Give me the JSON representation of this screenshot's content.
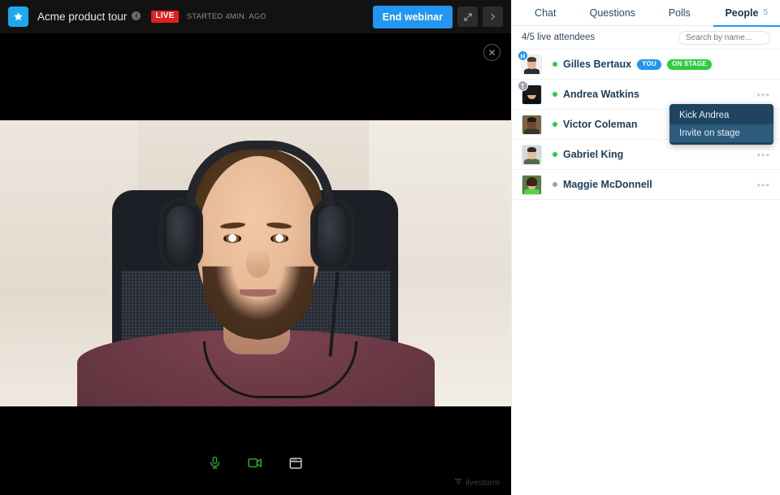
{
  "topbar": {
    "logo_icon": "star-icon",
    "title": "Acme product tour",
    "info_icon": "info-icon",
    "live_badge": "LIVE",
    "started_label": "STARTED 4MIN. AGO",
    "end_webinar_label": "End webinar",
    "expand_icon": "expand-arrows-icon",
    "collapse_icon": "chevron-right-icon",
    "accent_color": "#2196F3",
    "live_color": "#E02020"
  },
  "stage": {
    "close_icon": "close-icon",
    "controls": [
      {
        "name": "microphone-icon",
        "label": "Microphone",
        "state": "on",
        "color": "#22A532"
      },
      {
        "name": "camera-icon",
        "label": "Camera",
        "state": "on",
        "color": "#22A532"
      },
      {
        "name": "screen-share-icon",
        "label": "Share screen",
        "state": "off",
        "color": "#c9c9c9"
      }
    ],
    "watermark": "livestorm",
    "watermark_icon": "livestorm-icon"
  },
  "panel": {
    "tabs": [
      {
        "label": "Chat",
        "active": false,
        "count": ""
      },
      {
        "label": "Questions",
        "active": false,
        "count": ""
      },
      {
        "label": "Polls",
        "active": false,
        "count": ""
      },
      {
        "label": "People",
        "active": true,
        "count": "5"
      }
    ],
    "live_attendees": "4/5 live attendees",
    "search_placeholder": "Search by name...",
    "people": [
      {
        "name": "Gilles Bertaux",
        "status": "online",
        "role_badge": "H",
        "role_type": "host",
        "pills": [
          {
            "label": "YOU",
            "type": "you"
          },
          {
            "label": "ON STAGE",
            "type": "onstage"
          }
        ],
        "has_menu": false
      },
      {
        "name": "Andrea Watkins",
        "status": "online",
        "role_badge": "T",
        "role_type": "team",
        "pills": [],
        "has_menu": true
      },
      {
        "name": "Victor Coleman",
        "status": "online",
        "role_badge": "",
        "role_type": "",
        "pills": [],
        "has_menu": true
      },
      {
        "name": "Gabriel King",
        "status": "online",
        "role_badge": "",
        "role_type": "",
        "pills": [],
        "has_menu": true
      },
      {
        "name": "Maggie McDonnell",
        "status": "offline",
        "role_badge": "",
        "role_type": "",
        "pills": [],
        "has_menu": true
      }
    ],
    "context_menu": {
      "items": [
        {
          "label": "Kick Andrea",
          "highlighted": false
        },
        {
          "label": "Invite on stage",
          "highlighted": true
        }
      ]
    },
    "online_color": "#2ECC40",
    "offline_color": "#9aa4ad"
  }
}
